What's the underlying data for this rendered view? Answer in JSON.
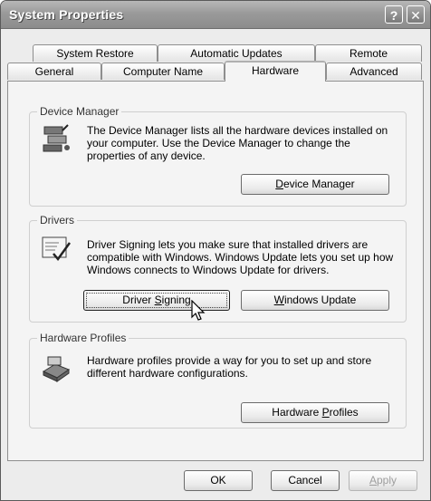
{
  "window": {
    "title": "System Properties",
    "help_glyph": "?",
    "close_glyph": "✕"
  },
  "tabs": {
    "back_row": [
      "System Restore",
      "Automatic Updates",
      "Remote"
    ],
    "front_row": [
      "General",
      "Computer Name",
      "Hardware",
      "Advanced"
    ],
    "active": "Hardware"
  },
  "device_manager": {
    "title": "Device Manager",
    "text": "The Device Manager lists all the hardware devices installed on your computer. Use the Device Manager to change the properties of any device.",
    "button": {
      "pre": "",
      "key": "D",
      "post": "evice Manager"
    },
    "icon": "device-manager-icon"
  },
  "drivers": {
    "title": "Drivers",
    "text": "Driver Signing lets you make sure that installed drivers are compatible with Windows. Windows Update lets you set up how Windows connects to Windows Update for drivers.",
    "signing_button": {
      "pre": "Driver ",
      "key": "S",
      "post": "igning"
    },
    "update_button": {
      "pre": "",
      "key": "W",
      "post": "indows Update"
    },
    "icon": "driver-signing-icon"
  },
  "hardware_profiles": {
    "title": "Hardware Profiles",
    "text": "Hardware profiles provide a way for you to set up and store different hardware configurations.",
    "button": {
      "pre": "Hardware ",
      "key": "P",
      "post": "rofiles"
    },
    "icon": "hardware-profiles-icon"
  },
  "footer": {
    "ok": "OK",
    "cancel": "Cancel",
    "apply": {
      "pre": "",
      "key": "A",
      "post": "pply"
    }
  }
}
